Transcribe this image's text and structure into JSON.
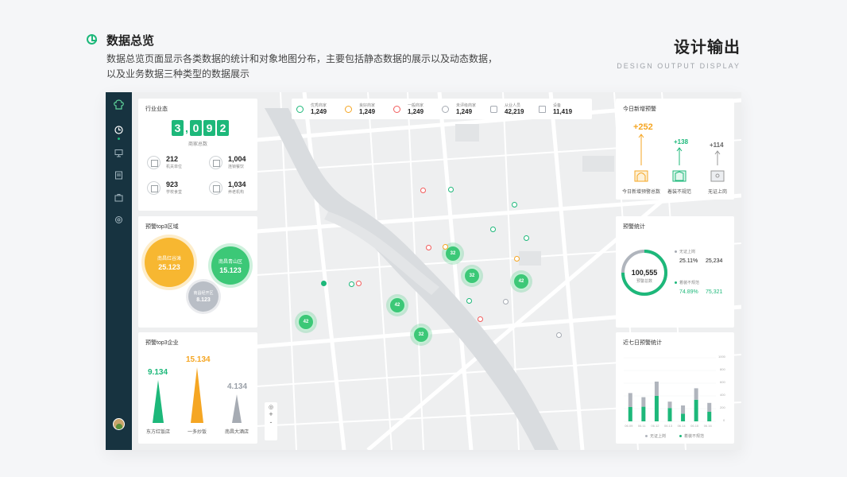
{
  "header": {
    "title": "数据总览",
    "desc": "数据总览页面显示各类数据的统计和对象地图分布，主要包括静态数据的展示以及动态数据，以及业务数据三种类型的数据展示",
    "right_title": "设计输出",
    "right_subtitle": "DESIGN OUTPUT DISPLAY"
  },
  "industry": {
    "title": "行业业态",
    "digits": [
      "3",
      "0",
      "9",
      "2"
    ],
    "caption": "商家总数",
    "stats": [
      {
        "value": "212",
        "label": "机关单位"
      },
      {
        "value": "1,004",
        "label": "连锁餐饮"
      },
      {
        "value": "923",
        "label": "学校食堂"
      },
      {
        "value": "1,034",
        "label": "养老机构"
      }
    ]
  },
  "top_regions": {
    "title": "预警top3区域",
    "items": [
      {
        "name": "南昌红谷滩",
        "value": "25.123",
        "color": "#f7b731"
      },
      {
        "name": "南昌青山区",
        "value": "15.123",
        "color": "#3cc877"
      },
      {
        "name": "南昌经开区",
        "value": "8.123",
        "color": "#b9bec6"
      }
    ]
  },
  "top_companies": {
    "title": "预警top3企业",
    "items": [
      {
        "name": "东方红饭店",
        "value": "9.134",
        "color": "#1db87a"
      },
      {
        "name": "一多炒饭",
        "value": "15.134",
        "color": "#f5a623"
      },
      {
        "name": "南昌大酒店",
        "value": "4.134",
        "color": "#a6abb3"
      }
    ]
  },
  "strip": [
    {
      "label": "优秀商家",
      "value": "1,249",
      "color": "#1db87a"
    },
    {
      "label": "良好商家",
      "value": "1,249",
      "color": "#f5a623"
    },
    {
      "label": "一般商家",
      "value": "1,249",
      "color": "#f25b5b"
    },
    {
      "label": "未评级商家",
      "value": "1,249",
      "color": "#a6abb3"
    },
    {
      "label": "从业人员",
      "value": "42,219",
      "color": "#a6abb3"
    },
    {
      "label": "设备",
      "value": "11,419",
      "color": "#a6abb3"
    }
  ],
  "clusters": [
    "32",
    "32",
    "42",
    "42",
    "42",
    "32"
  ],
  "zoom": {
    "plus": "+",
    "minus": "-"
  },
  "new_warnings": {
    "title": "今日新增预警",
    "items": [
      {
        "value": "+252",
        "label": "今日新增预警总数",
        "color": "#f5a623"
      },
      {
        "value": "+138",
        "label": "着装不规范",
        "color": "#1db87a"
      },
      {
        "value": "+114",
        "label": "无证上岗",
        "color": "#666666"
      }
    ]
  },
  "warning_stats": {
    "title": "预警统计",
    "total": "100,555",
    "total_label": "预警总数",
    "legend": [
      {
        "label": "无证上岗",
        "pct": "25.11%",
        "num": "25,234",
        "color": "#a6abb3"
      },
      {
        "label": "着装不规范",
        "pct": "74.89%",
        "num": "75,321",
        "color": "#1db87a"
      }
    ]
  },
  "weekly": {
    "title": "近七日预警统计",
    "y_ticks": [
      "1000",
      "800",
      "600",
      "400",
      "200",
      "0"
    ],
    "legend": [
      "无证上岗",
      "着装不规范"
    ]
  },
  "chart_data": {
    "type": "bar",
    "categories": [
      "06.09",
      "06.11",
      "06.12",
      "06.13",
      "06.14",
      "06.15",
      "06.16"
    ],
    "ylim": [
      0,
      1000
    ],
    "series": [
      {
        "name": "无证上岗",
        "values": [
          440,
          300,
          450,
          200,
          260,
          360,
          280
        ],
        "color": "#b0b5bd"
      },
      {
        "name": "着装不规范",
        "values": [
          450,
          460,
          800,
          420,
          240,
          680,
          300
        ],
        "color": "#1db87a"
      }
    ]
  }
}
